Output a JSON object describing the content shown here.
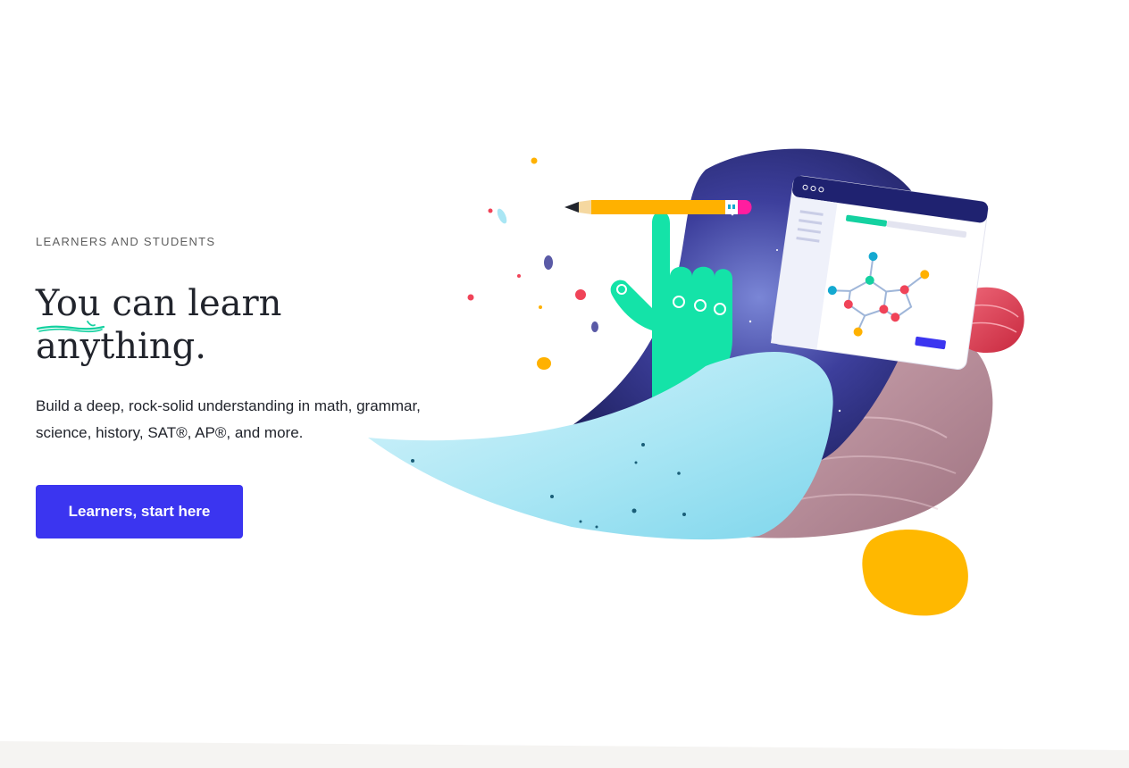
{
  "hero": {
    "eyebrow": "LEARNERS AND STUDENTS",
    "headline_line1": "You can learn",
    "headline_line2": "anything.",
    "description": "Build a deep, rock-solid understanding in math, grammar, science, history, SAT®, AP®, and more.",
    "cta_label": "Learners, start here"
  },
  "colors": {
    "accent": "#3b35f0",
    "highlight_green": "#14d1a0",
    "text": "#21242c"
  },
  "illustration": {
    "icons": [
      "pencil-icon",
      "hand-icon",
      "molecule-browser-icon",
      "nebula-shape",
      "rock-shapes"
    ]
  }
}
